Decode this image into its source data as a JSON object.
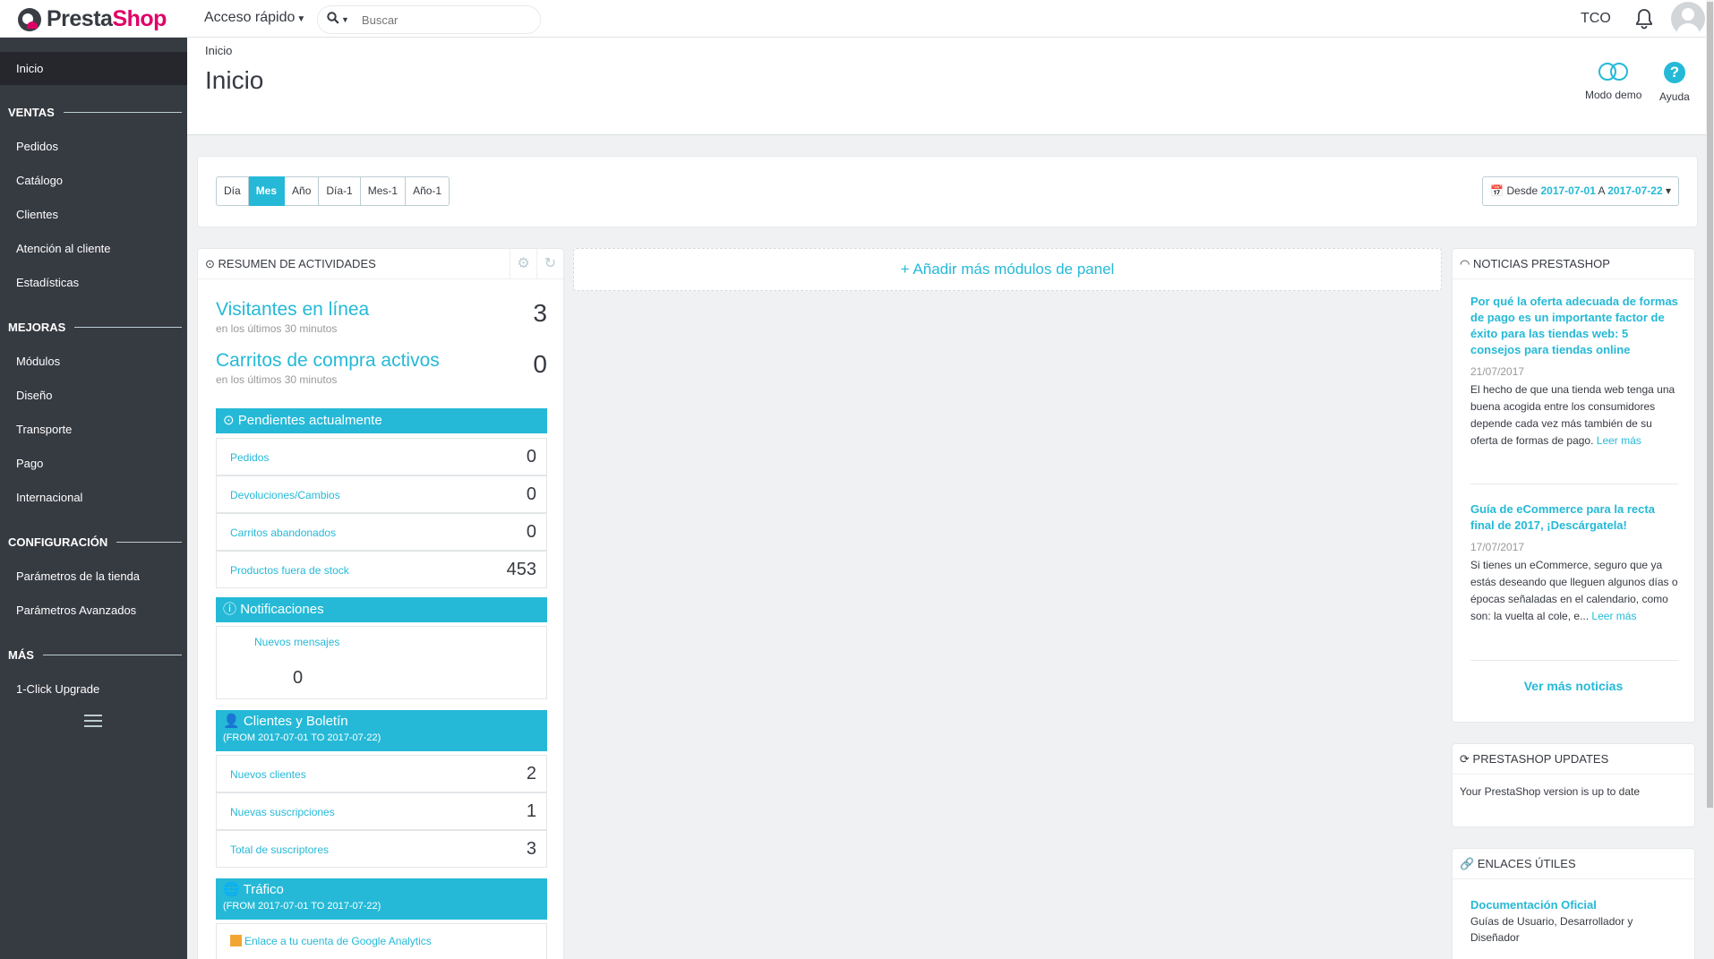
{
  "topbar": {
    "logo_part1": "Presta",
    "logo_part2": "Shop",
    "quick_access": "Acceso rápido",
    "search_placeholder": "Buscar",
    "shop_code": "TCO"
  },
  "sidebar": {
    "active": "Inicio",
    "sections": [
      {
        "title": "VENTAS",
        "items": [
          "Pedidos",
          "Catálogo",
          "Clientes",
          "Atención al cliente",
          "Estadísticas"
        ]
      },
      {
        "title": "MEJORAS",
        "items": [
          "Módulos",
          "Diseño",
          "Transporte",
          "Pago",
          "Internacional"
        ]
      },
      {
        "title": "CONFIGURACIÓN",
        "items": [
          "Parámetros de la tienda",
          "Parámetros Avanzados"
        ]
      },
      {
        "title": "MÁS",
        "items": [
          "1-Click Upgrade"
        ]
      }
    ]
  },
  "header": {
    "breadcrumb": "Inicio",
    "title": "Inicio",
    "demo_label": "Modo demo",
    "help_label": "Ayuda"
  },
  "period": {
    "buttons": [
      "Día",
      "Mes",
      "Año",
      "Día-1",
      "Mes-1",
      "Año-1"
    ],
    "active": "Mes",
    "date_from_label": "Desde",
    "date_from": "2017-07-01",
    "date_sep": "A",
    "date_to": "2017-07-22"
  },
  "activity": {
    "title": "RESUMEN DE ACTIVIDADES",
    "visitors_label": "Visitantes en línea",
    "visitors_sub": "en los últimos 30 minutos",
    "visitors_value": "3",
    "carts_label": "Carritos de compra activos",
    "carts_sub": "en los últimos 30 minutos",
    "carts_value": "0",
    "pending_title": "Pendientes actualmente",
    "pending": [
      {
        "label": "Pedidos",
        "value": "0"
      },
      {
        "label": "Devoluciones/Cambios",
        "value": "0"
      },
      {
        "label": "Carritos abandonados",
        "value": "0"
      },
      {
        "label": "Productos fuera de stock",
        "value": "453"
      }
    ],
    "notif_title": "Notificaciones",
    "notif_label": "Nuevos mensajes",
    "notif_value": "0",
    "customers_title": "Clientes y Boletín",
    "customers_sub": "(FROM 2017-07-01 TO 2017-07-22)",
    "customers": [
      {
        "label": "Nuevos clientes",
        "value": "2"
      },
      {
        "label": "Nuevas suscripciones",
        "value": "1"
      },
      {
        "label": "Total de suscriptores",
        "value": "3"
      }
    ],
    "traffic_title": "Tráfico",
    "traffic_sub": "(FROM 2017-07-01 TO 2017-07-22)",
    "traffic_link": "Enlace a tu cuenta de Google Analytics"
  },
  "add_modules": "Añadir más módulos de panel",
  "news": {
    "title": "NOTICIAS PRESTASHOP",
    "items": [
      {
        "title": "Por qué la oferta adecuada de formas de pago es un importante factor de éxito para las tiendas web: 5 consejos para tiendas online",
        "date": "21/07/2017",
        "body": "El hecho de que una tienda web tenga una buena acogida entre los consumidores depende cada vez más también de su oferta de formas de pago.",
        "more": "Leer más"
      },
      {
        "title": "Guía de eCommerce para la recta final de 2017, ¡Descárgatela!",
        "date": "17/07/2017",
        "body": " Si tienes un eCommerce, seguro que ya estás deseando que lleguen algunos días o épocas señaladas en el calendario, como son: la vuelta al cole, e...",
        "more": "Leer más"
      }
    ],
    "see_more": "Ver más noticias"
  },
  "updates": {
    "title": "PRESTASHOP UPDATES",
    "body": "Your PrestaShop version is up to date"
  },
  "links": {
    "title": "ENLACES ÚTILES",
    "item_title": "Documentación Oficial",
    "item_body": "Guías de Usuario, Desarrollador y Diseñador"
  },
  "colors": {
    "accent": "#25b9d7",
    "sidebar": "#363a41",
    "brand": "#df0067"
  }
}
